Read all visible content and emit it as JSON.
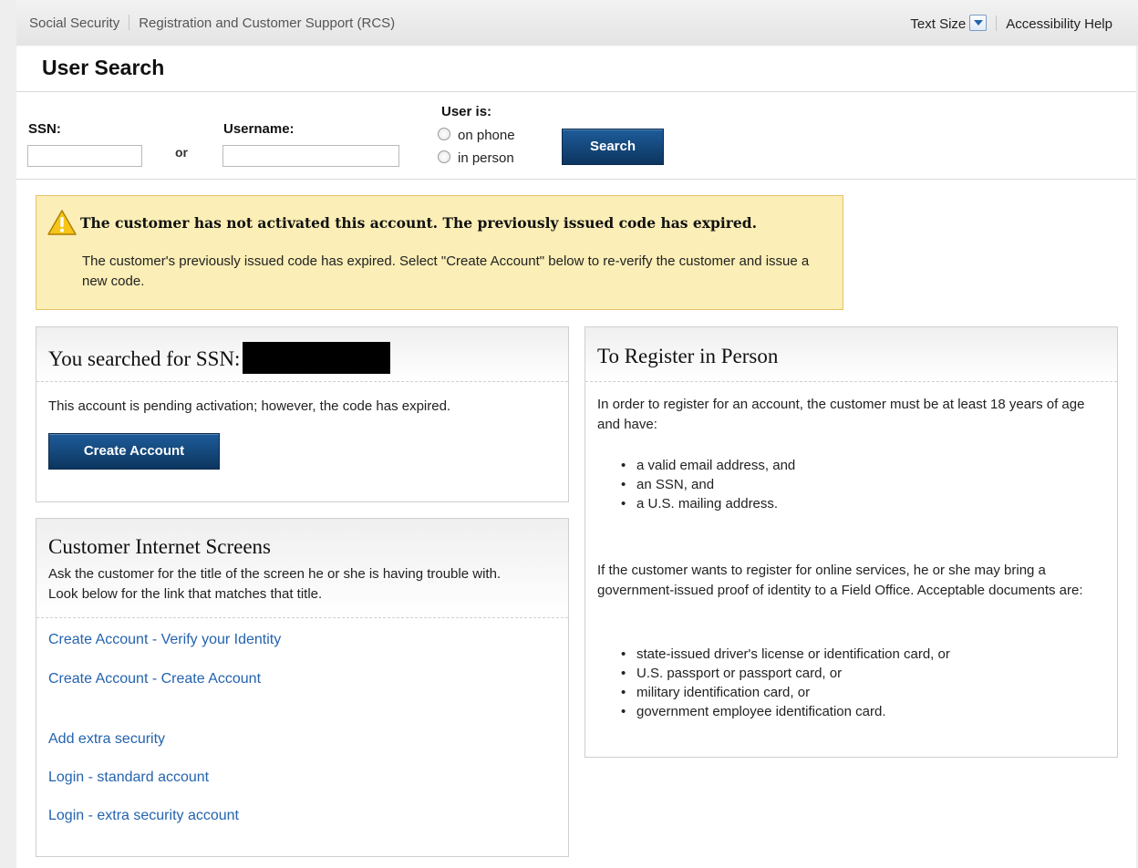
{
  "topbar": {
    "site_name": "Social Security",
    "app_name": "Registration and Customer Support (RCS)",
    "text_size_label": "Text Size",
    "accessibility_help": "Accessibility Help"
  },
  "page_title": "User Search",
  "search": {
    "ssn_label": "SSN:",
    "ssn_value": "",
    "or_label": "or",
    "username_label": "Username:",
    "username_value": "",
    "user_is_label": "User is:",
    "options": [
      "on phone",
      "in person"
    ],
    "search_button": "Search"
  },
  "alert": {
    "heading": "The customer has not activated this account. The previously issued code has expired.",
    "body": "The customer's previously issued code has expired. Select \"Create Account\" below to re-verify the customer and issue a new code."
  },
  "ssn_panel": {
    "title": "You searched for SSN:",
    "message": "This account is pending activation; however, the code has expired.",
    "create_button": "Create Account"
  },
  "screens_panel": {
    "title": "Customer Internet Screens",
    "description": "Ask the customer for the title of the screen he or she is having trouble with. Look below for the link that matches that title.",
    "links": [
      "Create Account - Verify your Identity",
      "Create Account - Create Account",
      "Add extra security",
      "Login - standard account",
      "Login - extra security account"
    ]
  },
  "register_panel": {
    "title": "To Register in Person",
    "intro": "In order to register for an account, the customer must be at least 18 years of age and have:",
    "requirements": [
      "a valid email address, and",
      "an SSN, and",
      "a U.S. mailing address."
    ],
    "online_text": "If the customer wants to register for online services, he or she may bring a government-issued proof of identity to a Field Office. Acceptable documents are:",
    "documents": [
      "state-issued driver's license or identification card, or",
      "U.S. passport or passport card, or",
      "military identification card, or",
      "government employee identification card."
    ]
  },
  "colors": {
    "link": "#2463ae",
    "button_dark": "#0c355f",
    "alert_bg": "#fbeeb6",
    "alert_border": "#e7c36b"
  },
  "icons": {
    "warning": "warning-icon",
    "dropdown": "chevron-down-icon",
    "radio": "radio-icon"
  }
}
